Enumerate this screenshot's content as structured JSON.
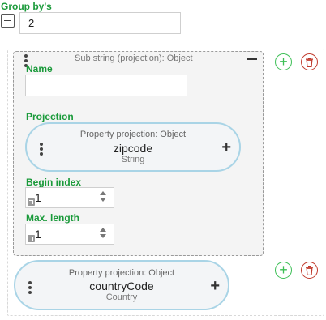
{
  "group_by": {
    "label": "Group by's",
    "value": "2"
  },
  "substring_card": {
    "title": "Sub string (projection): Object",
    "name_label": "Name",
    "name_value": "",
    "projection_label": "Projection",
    "projection": {
      "title": "Property projection: Object",
      "name": "zipcode",
      "type": "String"
    },
    "begin_index_label": "Begin index",
    "begin_index_value": "1",
    "max_length_label": "Max. length",
    "max_length_value": "1"
  },
  "second_projection": {
    "title": "Property projection: Object",
    "name": "countryCode",
    "type": "Country"
  },
  "colors": {
    "label_green": "#1a9a3a",
    "add_green": "#3cbf55",
    "delete_red": "#c0392b",
    "pill_border": "#a9d4e6"
  },
  "icons": {
    "add": "plus-circle-icon",
    "delete": "trash-icon",
    "drag": "vertical-dots-icon",
    "collapse": "minus-square-icon",
    "link": "link-arrow-icon"
  }
}
